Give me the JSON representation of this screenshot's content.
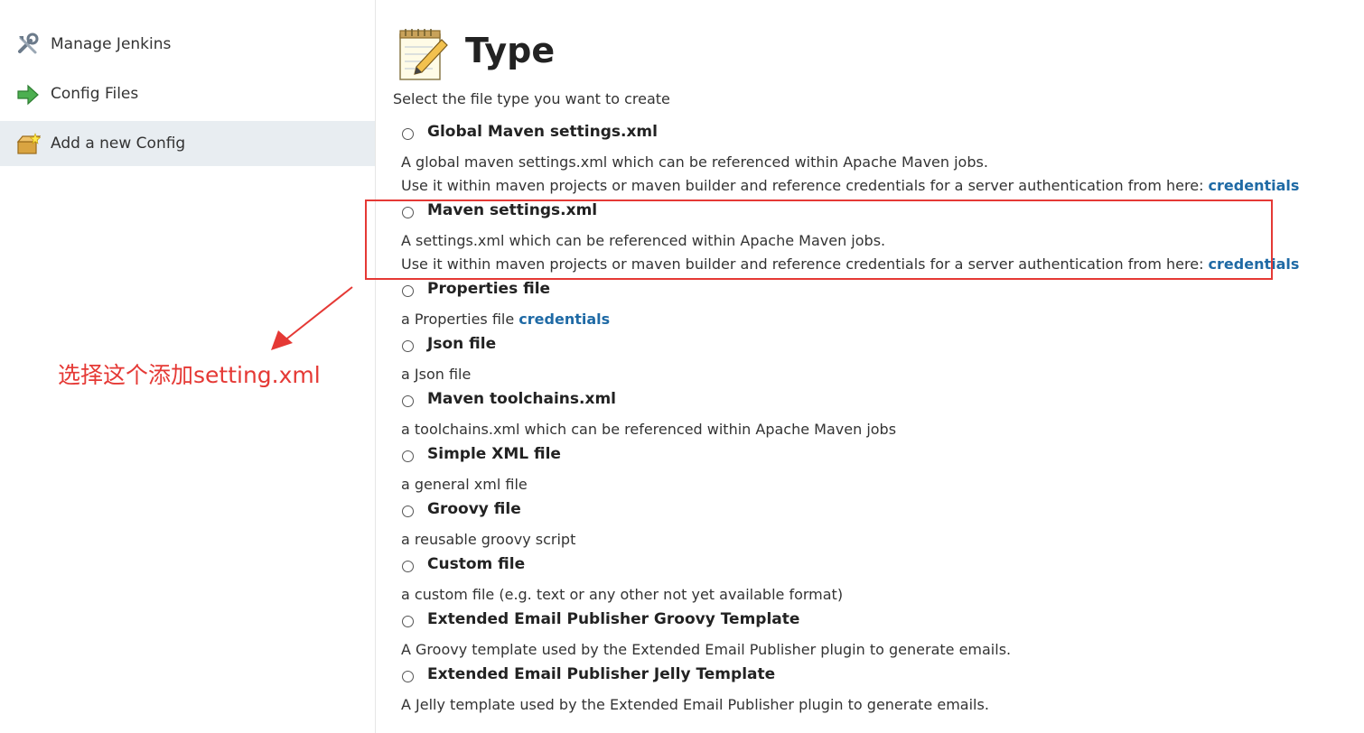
{
  "sidebar": {
    "items": [
      {
        "label": "Manage Jenkins",
        "icon": "tools-icon"
      },
      {
        "label": "Config Files",
        "icon": "arrow-right-icon"
      },
      {
        "label": "Add a new Config",
        "icon": "add-box-icon",
        "active": true
      }
    ]
  },
  "main": {
    "title": "Type",
    "title_icon": "notepad-icon",
    "subtitle": "Select the file type you want to create",
    "options": [
      {
        "label": "Global Maven settings.xml",
        "lines": [
          "A global maven settings.xml which can be referenced within Apache Maven jobs.",
          "Use it within maven projects or maven builder and reference credentials for a server authentication from here: "
        ],
        "link": "credentials"
      },
      {
        "label": "Maven settings.xml",
        "lines": [
          "A settings.xml which can be referenced within Apache Maven jobs.",
          "Use it within maven projects or maven builder and reference credentials for a server authentication from here: "
        ],
        "link": "credentials"
      },
      {
        "label": "Properties file",
        "lines": [
          "a Properties file "
        ],
        "link": "credentials"
      },
      {
        "label": "Json file",
        "lines": [
          "a Json file"
        ]
      },
      {
        "label": "Maven toolchains.xml",
        "lines": [
          "a toolchains.xml which can be referenced within Apache Maven jobs"
        ]
      },
      {
        "label": "Simple XML file",
        "lines": [
          "a general xml file"
        ]
      },
      {
        "label": "Groovy file",
        "lines": [
          "a reusable groovy script"
        ]
      },
      {
        "label": "Custom file",
        "lines": [
          "a custom file (e.g. text or any other not yet available format)"
        ]
      },
      {
        "label": "Extended Email Publisher Groovy Template",
        "lines": [
          "A Groovy template used by the Extended Email Publisher plugin to generate emails."
        ]
      },
      {
        "label": "Extended Email Publisher Jelly Template",
        "lines": [
          "A Jelly template used by the Extended Email Publisher plugin to generate emails."
        ]
      }
    ]
  },
  "annotation": {
    "text": "选择这个添加setting.xml",
    "color": "#e53935"
  },
  "colors": {
    "link": "#1f6aa5",
    "sidebar_active": "#e8edf1",
    "highlight": "#e53935"
  }
}
